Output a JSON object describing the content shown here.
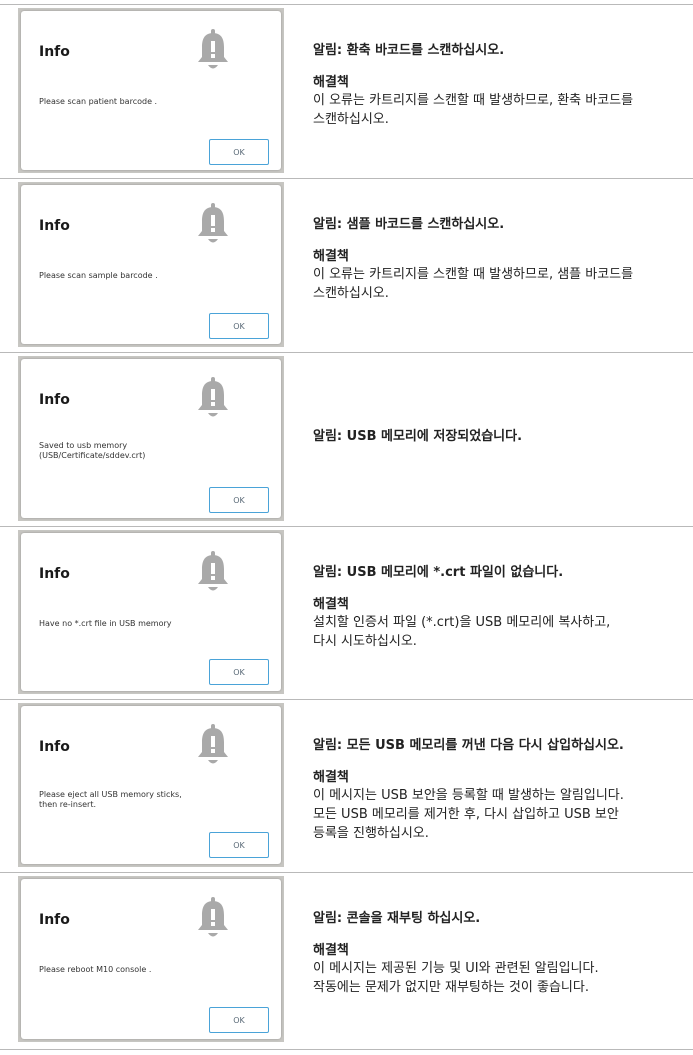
{
  "solution_heading": "해결책",
  "ok_label": "OK",
  "entries": [
    {
      "dialog_title": "Info",
      "dialog_message": "Please scan patient barcode .",
      "alert": "알림: 환축 바코드를 스캔하십시오.",
      "solution_lines": [
        "이 오류는 카트리지를 스캔할 때 발생하므로, 환축 바코드를",
        "스캔하십시오."
      ]
    },
    {
      "dialog_title": "Info",
      "dialog_message": "Please scan sample barcode .",
      "alert": "알림: 샘플 바코드를 스캔하십시오.",
      "solution_lines": [
        "이 오류는 카트리지를 스캔할 때 발생하므로, 샘플 바코드를",
        "스캔하십시오."
      ]
    },
    {
      "dialog_title": "Info",
      "dialog_message": "Saved to usb memory\n(USB/Certificate/sddev.crt)",
      "alert": "알림: USB 메모리에 저장되었습니다.",
      "solution_lines": []
    },
    {
      "dialog_title": "Info",
      "dialog_message": "Have no *.crt file in USB memory",
      "alert": "알림: USB 메모리에 *.crt 파일이 없습니다.",
      "solution_lines": [
        "설치할 인증서 파일 (*.crt)을 USB 메모리에 복사하고,",
        "다시 시도하십시오."
      ]
    },
    {
      "dialog_title": "Info",
      "dialog_message": "Please eject all USB memory sticks,\nthen re-insert.",
      "alert": "알림: 모든 USB 메모리를 꺼낸 다음 다시 삽입하십시오.",
      "solution_lines": [
        "이 메시지는 USB 보안을 등록할 때 발생하는 알림입니다.",
        "모든 USB 메모리를 제거한 후, 다시 삽입하고 USB 보안",
        "등록을 진행하십시오."
      ]
    },
    {
      "dialog_title": "Info",
      "dialog_message": "Please reboot M10 console .",
      "alert": "알림: 콘솔을 재부팅 하십시오.",
      "solution_lines": [
        "이 메시지는 제공된 기능 및 UI와 관련된 알림입니다.",
        "작동에는 문제가 없지만 재부팅하는 것이 좋습니다."
      ]
    }
  ]
}
